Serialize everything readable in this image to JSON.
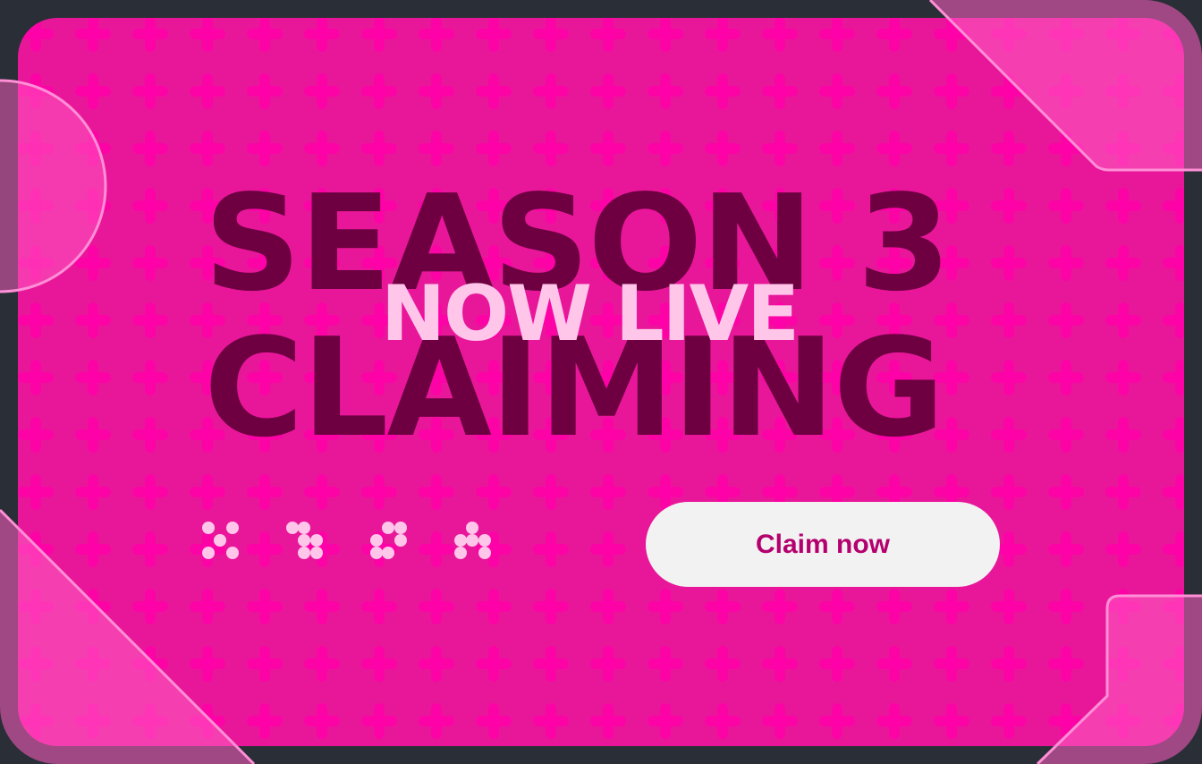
{
  "banner": {
    "headline_line1": "SEASON 3",
    "headline_overlay": "NOW LIVE",
    "headline_line2": "CLAIMING",
    "cta_label": "Claim now",
    "icons": [
      "dots-pattern-icon",
      "dots-pattern-icon",
      "dots-pattern-icon",
      "dots-pattern-icon"
    ]
  },
  "colors": {
    "background": "#e8179a",
    "plus_pattern": "#ff00a8",
    "headline": "#6e0041",
    "overlay_text": "#ffc6ea",
    "button_bg": "#f2f2f2",
    "button_text": "#b4006e",
    "frame": "#2a2e37"
  }
}
